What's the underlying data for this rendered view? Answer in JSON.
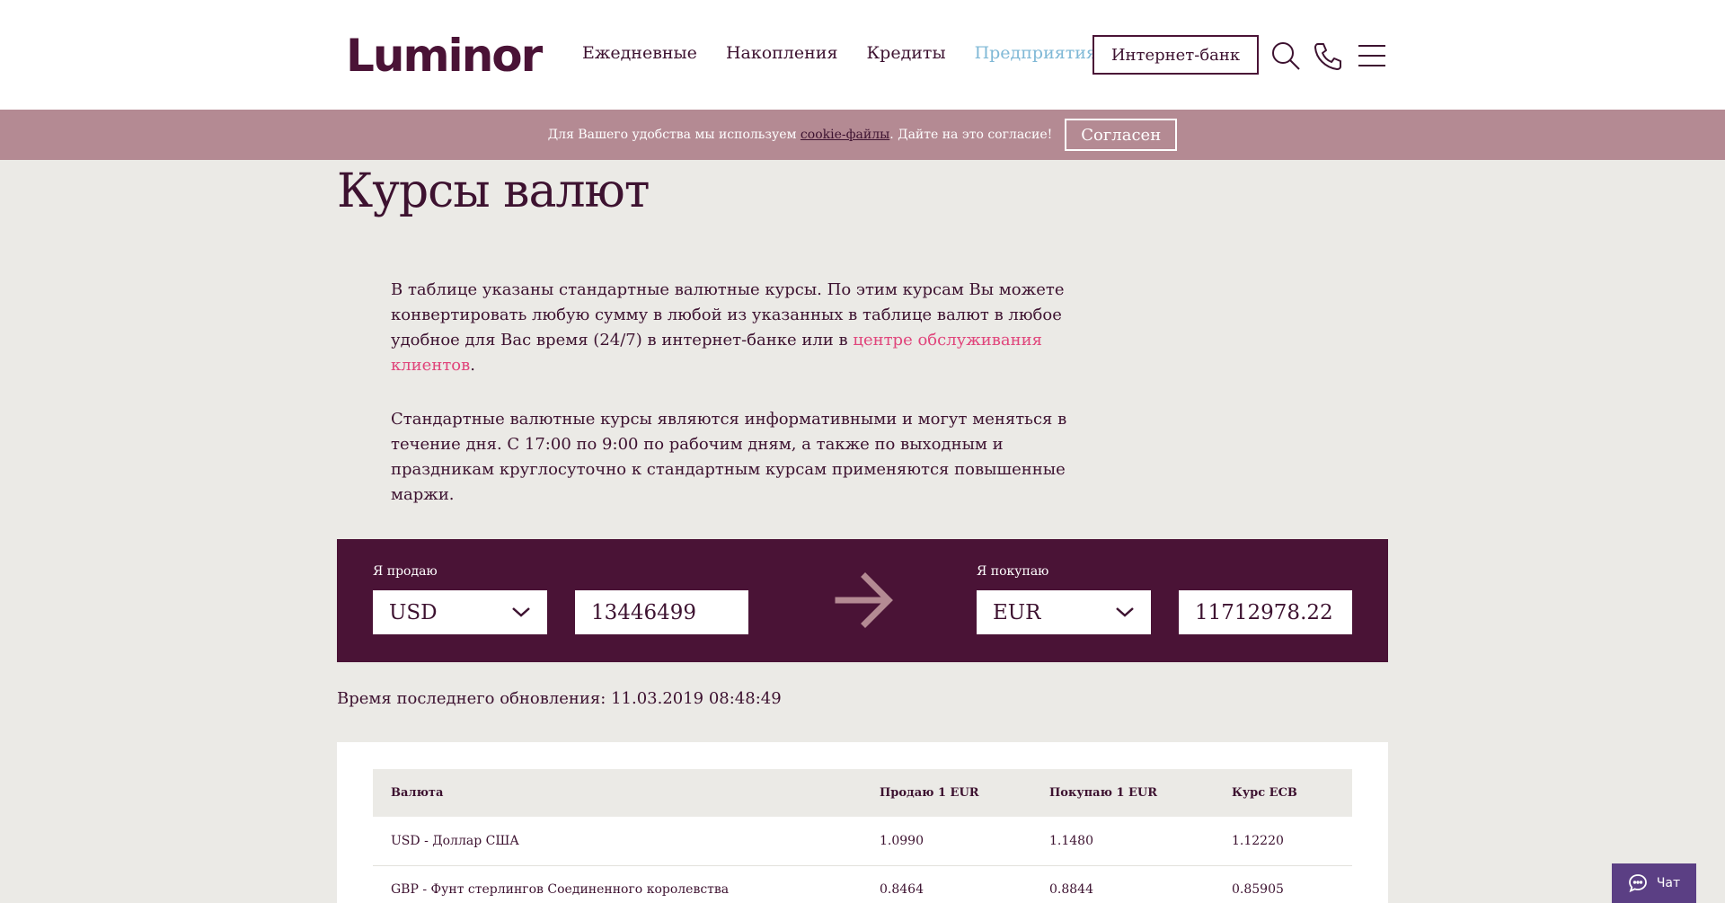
{
  "header": {
    "logo": "Luminor",
    "nav": [
      "Ежедневные",
      "Накопления",
      "Кредиты",
      "Предприятиям"
    ],
    "internet_bank": "Интернет-банк",
    "icons": [
      "search-icon",
      "phone-icon",
      "menu-icon"
    ]
  },
  "cookie": {
    "text_before": "Для Вашего удобства мы используем",
    "link": "cookie-файлы",
    "text_after": "Дайте на это согласие!",
    "accept": "Согласен"
  },
  "page": {
    "title": "Курсы валют",
    "intro_1": "В таблице указаны стандартные валютные курсы. По этим курсам Вы можете конвертировать любую сумму в любой из указанных в таблице валют в любое удобное для Вас время (24/7) в интернет-банке или в",
    "intro_1_link": "центре обслуживания клиентов",
    "intro_1_end": ".",
    "intro_2": "Стандартные валютные курсы являются информативными и могут меняться в течение дня. С 17:00 по 9:00 по рабочим дням, а также по выходным и праздникам круглосуточно к стандартным курсам применяются повышенные маржи."
  },
  "converter": {
    "sell_label": "Я продаю",
    "sell_currency": "USD",
    "sell_amount": "13446499",
    "buy_label": "Я покупаю",
    "buy_currency": "EUR",
    "buy_amount": "11712978.22"
  },
  "update_time": "Время последнего обновления: 11.03.2019 08:48:49",
  "table": {
    "headers": [
      "Валюта",
      "Продаю 1 EUR",
      "Покупаю 1 EUR",
      "Курс ECB"
    ],
    "rows": [
      [
        "USD - Доллар США",
        "1.0990",
        "1.1480",
        "1.12220"
      ],
      [
        "GBP - Фунт стерлингов Соединенного королевства",
        "0.8464",
        "0.8844",
        "0.85905"
      ]
    ]
  },
  "chat": {
    "label": "Чат"
  },
  "colors": {
    "brand": "#4a1336",
    "cookie_bar": "#b48a93",
    "link_pink": "#e0457b",
    "nav_active": "#7fb8d6",
    "chat": "#5b3f84",
    "background": "#ebeae6"
  }
}
